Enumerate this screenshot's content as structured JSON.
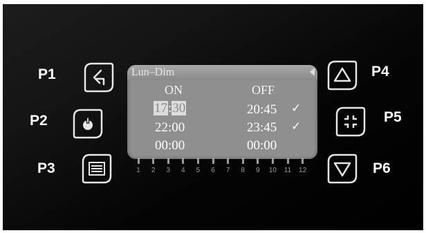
{
  "labels": {
    "p1": "P1",
    "p2": "P2",
    "p3": "P3",
    "p4": "P4",
    "p5": "P5",
    "p6": "P6"
  },
  "screen": {
    "title": "Lun–Dim",
    "col_on": "ON",
    "col_off": "OFF",
    "rows": [
      {
        "on_h": "17",
        "on_sep": ":",
        "on_m": "30",
        "off": "20:45",
        "check": "✓"
      },
      {
        "on": "22:00",
        "off": "23:45",
        "check": "✓"
      },
      {
        "on": "00:00",
        "off": "00:00"
      }
    ]
  },
  "timeline": [
    "1",
    "2",
    "3",
    "4",
    "5",
    "6",
    "7",
    "8",
    "9",
    "10",
    "11",
    "12"
  ],
  "icons": {
    "p1": "back-arrow-icon",
    "p2": "power-icon",
    "p3": "menu-list-icon",
    "p4": "up-arrow-icon",
    "p5": "select-corners-icon",
    "p6": "down-arrow-icon"
  }
}
